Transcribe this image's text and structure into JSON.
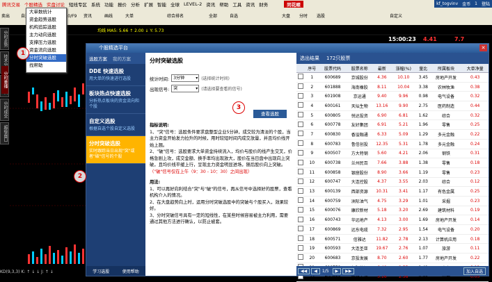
{
  "menubar": {
    "items": [
      "腾讯交易",
      "个股精选",
      "实盘讨论",
      "短线专区",
      "系统",
      "功能",
      "报价",
      "分析",
      "扩展",
      "智能",
      "全球",
      "LEVEL-2",
      "资讯",
      "帮助",
      "工具",
      "资讯",
      "财务"
    ],
    "brand": "同花顺",
    "right": [
      "kf_togvinv",
      "金币",
      "1",
      "登陆"
    ]
  },
  "dropdown": {
    "items": [
      "大单数统计",
      "资金趋势选股",
      "机构追踪选股",
      "主力动向选股",
      "支撑压力选股",
      "资金流向选股",
      "分时突破选股",
      "找帮助"
    ],
    "selected_index": 6
  },
  "toolbar": {
    "buttons": [
      "卖出",
      "自选股",
      "同期",
      "F10/F9",
      "资讯",
      "画线",
      "大单",
      "综合排名",
      "全部",
      "自选",
      "大盘",
      "分时",
      "选股",
      "自定义"
    ]
  },
  "chart": {
    "info_line": "均线 MA5: 5.66  ↑  2.00  ↓  Y: 5.73",
    "time": "15:00:23",
    "value_1": "4.41",
    "value_2": "7.7",
    "vtabs": [
      "分时走势",
      "技术分析",
      "个股资料",
      "分时成交",
      "超级盘口"
    ],
    "red_tab": "分时重播",
    "status": "KD(9,3,3) K:   ↑  ↓  ↓  J:  ↑  ↓"
  },
  "dialog": {
    "title": "个股精选平台",
    "close": "✕",
    "left": {
      "tabs": [
        "选股方案",
        "我的方案"
      ],
      "items": [
        {
          "title": "DDE 快速选股",
          "desc": "用大单的快速进行选股"
        },
        {
          "title": "板块热点快速选股",
          "desc": "分析热点板块的资金流向和个股"
        },
        {
          "title": "自定义选股",
          "desc": "根据自选个股自定义选股"
        },
        {
          "title": "分时突破选股",
          "desc": "实时跟踪当日出现\"突\"或者\"破\"信号的个股"
        }
      ],
      "active_index": 3,
      "bottom": [
        "学习选股",
        "使用帮助"
      ]
    },
    "mid": {
      "title": "分时突破选股",
      "row1_label": "统计时间:",
      "row1_value": "3分钟",
      "row1_hint": "(选择统计时间)",
      "row2_label": "出现信号:",
      "row2_value": "突",
      "row2_hint": "(请选择要查看的信号)",
      "query_button": "查看选股",
      "intro_title": "指标说明:",
      "intro_1": "1、\"突\"信号：选股条件要求盘整型企业5分钟，成交较为清淡的个股，当主力资金开始发力拉升的时候，用时较短时间内成交放量，并且均价线开始上翘。",
      "intro_2": "2、\"破\"信号：选股要求大单资金持续流入，均价与股价的线产生交叉，价格急剧上攻，成交金额、换手率均出现放大，股价在当日盘中出现向上突破，且均价线平缓上行，呈现主力资金明显进场，随后股价向上突破。",
      "intro_red": "（\"破\"信号仅在上午（9：30 - 10：30）之间出现）",
      "usage_title": "用法:",
      "usage_1": "1、可以再好向利结合\"突\"与\"破\"的信号，再从信号中选择好的股票，查看机构介入的情况。",
      "usage_2": "2、在大盘趋势向上时，运用分时突破选股中的突破与个股买入，效果较好。",
      "usage_3": "3、分时突破信号具有一定的短线性，在某些时候容易被主力利用，需要通过其他方法进行确认，以防止被套。"
    },
    "right": {
      "tabs": [
        "选出结果",
        "172只股票"
      ],
      "columns": [
        "",
        "序号",
        "股票代码",
        "股票名称",
        "最新",
        "涨幅(%)",
        "量比",
        "所属板块",
        "大单净量"
      ],
      "rows": [
        [
          "1",
          "600689",
          "京城股份",
          "4.36",
          "10.10",
          "3.45",
          "房地产开发",
          "0.43"
        ],
        [
          "2",
          "601888",
          "海南橡胶",
          "8.11",
          "10.04",
          "3.38",
          "农林牧渔",
          "0.38"
        ],
        [
          "3",
          "601908",
          "京运通",
          "9.40",
          "9.96",
          "0.98",
          "电气设备",
          "0.32"
        ],
        [
          "4",
          "600161",
          "天坛生物",
          "13.16",
          "9.90",
          "2.75",
          "医药制造",
          "0.44"
        ],
        [
          "5",
          "600805",
          "悦达投资",
          "6.90",
          "6.81",
          "1.62",
          "综合",
          "0.32"
        ],
        [
          "6",
          "600778",
          "友好集团",
          "6.91",
          "5.21",
          "1.96",
          "零售",
          "0.25"
        ],
        [
          "7",
          "600830",
          "香溢融通",
          "6.33",
          "5.09",
          "1.29",
          "多元金融",
          "0.22"
        ],
        [
          "8",
          "600783",
          "鲁信创投",
          "12.35",
          "5.31",
          "1.78",
          "多元金融",
          "0.24"
        ],
        [
          "9",
          "600507",
          "方大特钢",
          "5.60",
          "4.21",
          "2.06",
          "钢铁",
          "0.31"
        ],
        [
          "10",
          "600738",
          "兰州民百",
          "7.66",
          "3.88",
          "1.38",
          "零售",
          "0.18"
        ],
        [
          "11",
          "600858",
          "银座股份",
          "8.90",
          "3.66",
          "1.19",
          "零售",
          "0.23"
        ],
        [
          "12",
          "600747",
          "大连控股",
          "4.37",
          "3.55",
          "2.03",
          "综合",
          "0.12"
        ],
        [
          "13",
          "600139",
          "西部资源",
          "10.31",
          "3.41",
          "1.17",
          "有色金属",
          "0.25"
        ],
        [
          "14",
          "600759",
          "洲际油气",
          "4.75",
          "3.29",
          "1.01",
          "采掘",
          "0.23"
        ],
        [
          "15",
          "600076",
          "康欣新材",
          "5.18",
          "3.20",
          "2.69",
          "建筑材料",
          "0.19"
        ],
        [
          "16",
          "600743",
          "华远地产",
          "4.13",
          "3.00",
          "1.69",
          "房地产开发",
          "0.14"
        ],
        [
          "17",
          "600869",
          "远东电缆",
          "7.32",
          "2.95",
          "1.54",
          "电气设备",
          "0.20"
        ],
        [
          "18",
          "600571",
          "信雅达",
          "11.82",
          "2.78",
          "2.13",
          "计算机应用",
          "0.18"
        ],
        [
          "19",
          "600593",
          "大连圣亚",
          "19.67",
          "2.76",
          "1.07",
          "旅游",
          "0.11"
        ],
        [
          "20",
          "600683",
          "京投发展",
          "8.70",
          "2.60",
          "1.77",
          "房地产开发",
          "0.22"
        ],
        [
          "21",
          "600758",
          "红阳能源",
          "6.40",
          "2.55",
          "1.41",
          "电力",
          "0.12"
        ],
        [
          "22",
          "600868",
          "梅雁吉祥",
          "3.16",
          "2.38",
          "0.94",
          "电力",
          "0.05"
        ]
      ],
      "pager": "1/5",
      "footer_btn": "加入自选"
    }
  },
  "annotations": [
    "1",
    "2",
    "3"
  ]
}
